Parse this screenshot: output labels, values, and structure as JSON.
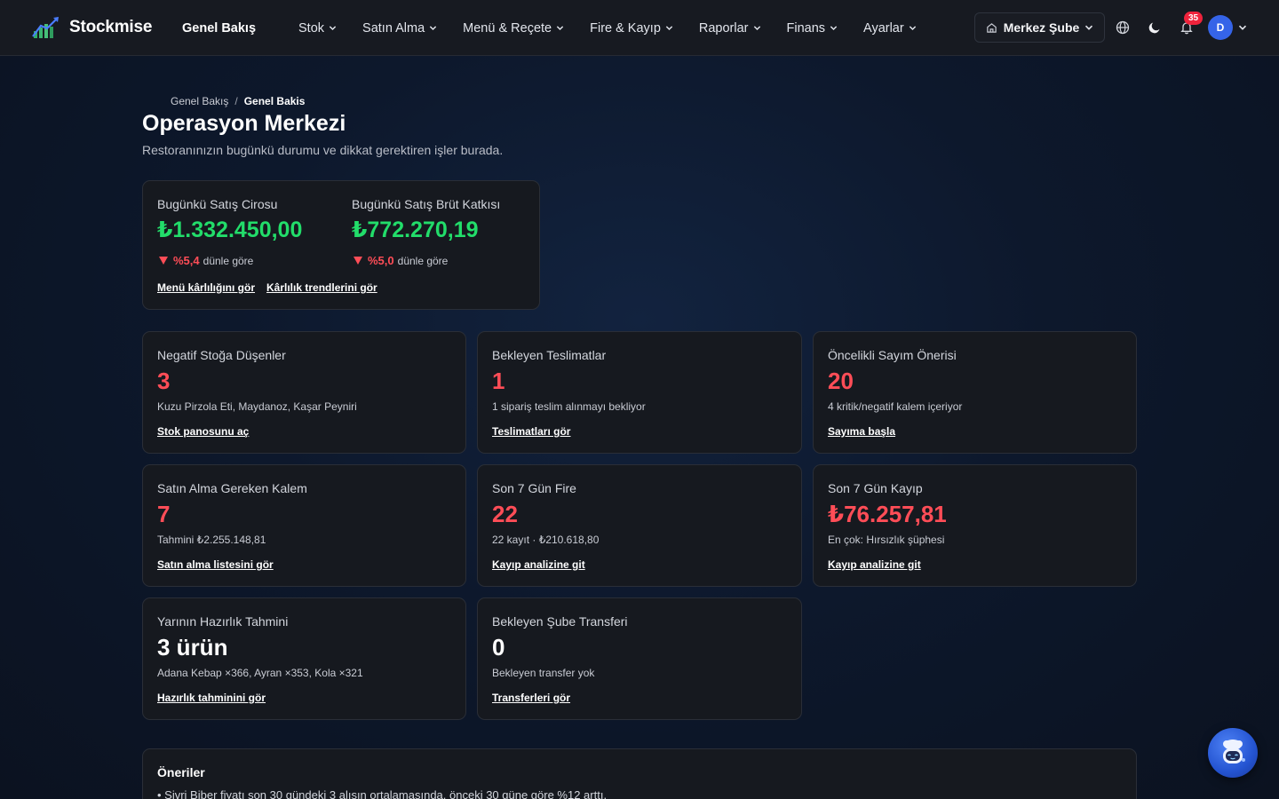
{
  "brand": {
    "name": "Stockmise",
    "logo_icon": "bar-chart-logo-icon"
  },
  "nav": {
    "items": [
      {
        "label": "Genel Bakış",
        "dropdown": false,
        "active": true
      },
      {
        "label": "Stok",
        "dropdown": true
      },
      {
        "label": "Satın Alma",
        "dropdown": true
      },
      {
        "label": "Menü & Reçete",
        "dropdown": true
      },
      {
        "label": "Fire & Kayıp",
        "dropdown": true
      },
      {
        "label": "Raporlar",
        "dropdown": true
      },
      {
        "label": "Finans",
        "dropdown": true
      },
      {
        "label": "Ayarlar",
        "dropdown": true
      }
    ]
  },
  "header_actions": {
    "branch_label": "Merkez Şube",
    "branch_icon": "store-icon",
    "language_icon": "globe-icon",
    "theme_icon": "moon-icon",
    "notifications_icon": "bell-icon",
    "notification_count": "35",
    "avatar_initial": "D"
  },
  "breadcrumb": {
    "root": "Genel Bakış",
    "separator": "/",
    "current": "Genel Bakis"
  },
  "page": {
    "title": "Operasyon Merkezi",
    "subtitle": "Restoranınızın bugünkü durumu ve dikkat gerektiren işler burada."
  },
  "sales": {
    "revenue": {
      "label": "Bugünkü Satış Cirosu",
      "value": "₺1.332.450,00",
      "change": "%5,4",
      "change_suffix": "dünle göre",
      "direction": "down"
    },
    "gross": {
      "label": "Bugünkü Satış Brüt Katkısı",
      "value": "₺772.270,19",
      "change": "%5,0",
      "change_suffix": "dünle göre",
      "direction": "down"
    },
    "links": [
      "Menü kârlılığını gör",
      "Kârlılık trendlerini gör"
    ]
  },
  "cards": [
    {
      "label": "Negatif Stoğa Düşenler",
      "value": "3",
      "desc": "Kuzu Pirzola Eti, Maydanoz, Kaşar Peyniri",
      "link": "Stok panosunu aç",
      "tone": "red"
    },
    {
      "label": "Bekleyen Teslimatlar",
      "value": "1",
      "desc": "1 sipariş teslim alınmayı bekliyor",
      "link": "Teslimatları gör",
      "tone": "red"
    },
    {
      "label": "Öncelikli Sayım Önerisi",
      "value": "20",
      "desc": "4 kritik/negatif kalem içeriyor",
      "link": "Sayıma başla",
      "tone": "red"
    },
    {
      "label": "Satın Alma Gereken Kalem",
      "value": "7",
      "desc": "Tahmini ₺2.255.148,81",
      "link": "Satın alma listesini gör",
      "tone": "red"
    },
    {
      "label": "Son 7 Gün Fire",
      "value": "22",
      "desc": "22 kayıt · ₺210.618,80",
      "link": "Kayıp analizine git",
      "tone": "red"
    },
    {
      "label": "Son 7 Gün Kayıp",
      "value": "₺76.257,81",
      "desc": "En çok: Hırsızlık şüphesi",
      "link": "Kayıp analizine git",
      "tone": "red"
    },
    {
      "label": "Yarının Hazırlık Tahmini",
      "value": "3 ürün",
      "desc": "Adana Kebap ×366, Ayran ×353, Kola ×321",
      "link": "Hazırlık tahminini gör",
      "tone": "white"
    },
    {
      "label": "Bekleyen Şube Transferi",
      "value": "0",
      "desc": "Bekleyen transfer yok",
      "link": "Transferleri gör",
      "tone": "white"
    }
  ],
  "suggestions": {
    "title": "Öneriler",
    "items": [
      "• Sivri Biber fiyatı son 30 gündeki 3 alışın ortalamasında, önceki 30 güne göre %12 arttı."
    ]
  },
  "assistant": {
    "icon": "chef-robot-icon"
  },
  "colors": {
    "positive": "#22dd6a",
    "negative": "#ff4d57",
    "accent": "#3564e8",
    "badge": "#ef233c"
  }
}
